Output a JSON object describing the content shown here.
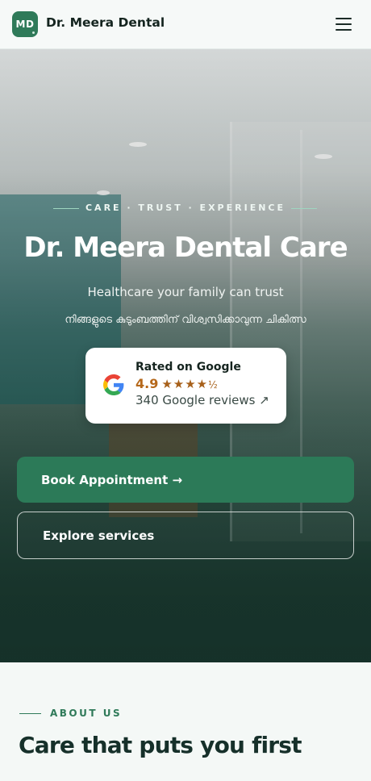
{
  "header": {
    "logo_initials": "MD",
    "brand_name": "Dr. Meera Dental",
    "menu_icon": "hamburger-menu-icon"
  },
  "hero": {
    "tagline": "CARE · TRUST · EXPERIENCE",
    "title": "Dr. Meera Dental Care",
    "subtitle": "Healthcare your family can trust",
    "subtitle_malayalam": "നിങ്ങളുടെ കുടുംബത്തിന് വിശ്വസിക്കാവുന്ന ചികിത്സ",
    "rating": {
      "title": "Rated on Google",
      "value": "4.9",
      "stars": "★★★★",
      "half_star": "½",
      "reviews_text": "340 Google reviews ↗",
      "icon": "google-g-icon"
    },
    "primary_button": "Book Appointment →",
    "secondary_button": "Explore services"
  },
  "about": {
    "label": "ABOUT US",
    "heading": "Care that puts you first"
  },
  "colors": {
    "brand_green": "#2c7a58",
    "star_gold": "#a7601a",
    "hero_dark": "#18332b"
  }
}
